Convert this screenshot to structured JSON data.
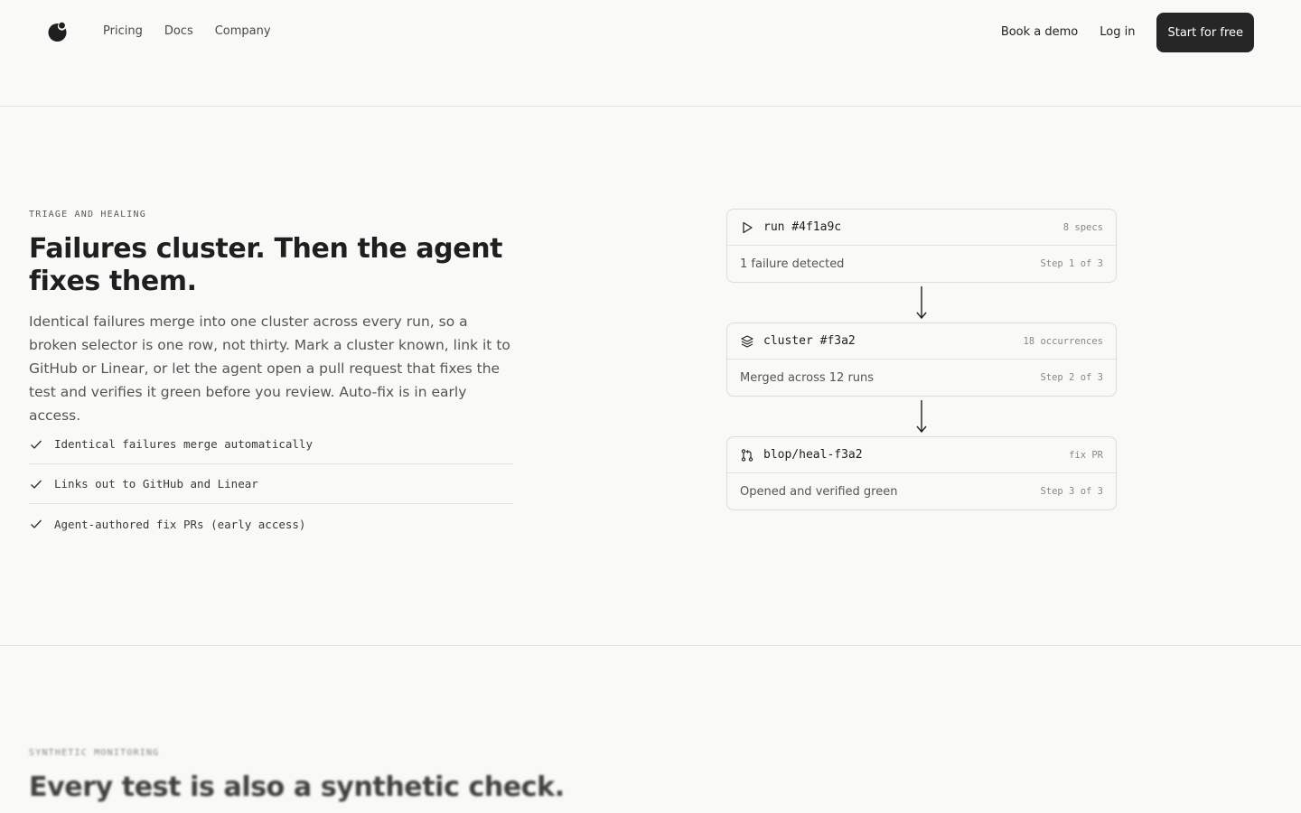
{
  "nav": {
    "links": [
      "Pricing",
      "Docs",
      "Company"
    ],
    "book_demo": "Book a demo",
    "login": "Log in",
    "cta": "Start for free"
  },
  "hero": {
    "eyebrow": "TRIAGE AND HEALING",
    "title": "Failures cluster. Then the agent fixes them.",
    "description": "Identical failures merge into one cluster across every run, so a broken selector is one row, not thirty. Mark a cluster known, link it to GitHub or Linear, or let the agent open a pull request that fixes the test and verifies it green before you review. Auto-fix is in early access.",
    "features": [
      "Identical failures merge automatically",
      "Links out to GitHub and Linear",
      "Agent-authored fix PRs (early access)"
    ]
  },
  "flow": [
    {
      "icon": "play-icon",
      "name": "run #4f1a9c",
      "meta": "8 specs",
      "status": "1 failure detected",
      "step": "Step 1 of 3"
    },
    {
      "icon": "layers-icon",
      "name": "cluster #f3a2",
      "meta": "18 occurrences",
      "status": "Merged across 12 runs",
      "step": "Step 2 of 3"
    },
    {
      "icon": "git-pull-request-icon",
      "name": "blop/heal-f3a2",
      "meta": "fix PR",
      "status": "Opened and verified green",
      "step": "Step 3 of 3"
    }
  ],
  "next_section": {
    "eyebrow": "SYNTHETIC MONITORING",
    "title": "Every test is also a synthetic check."
  }
}
